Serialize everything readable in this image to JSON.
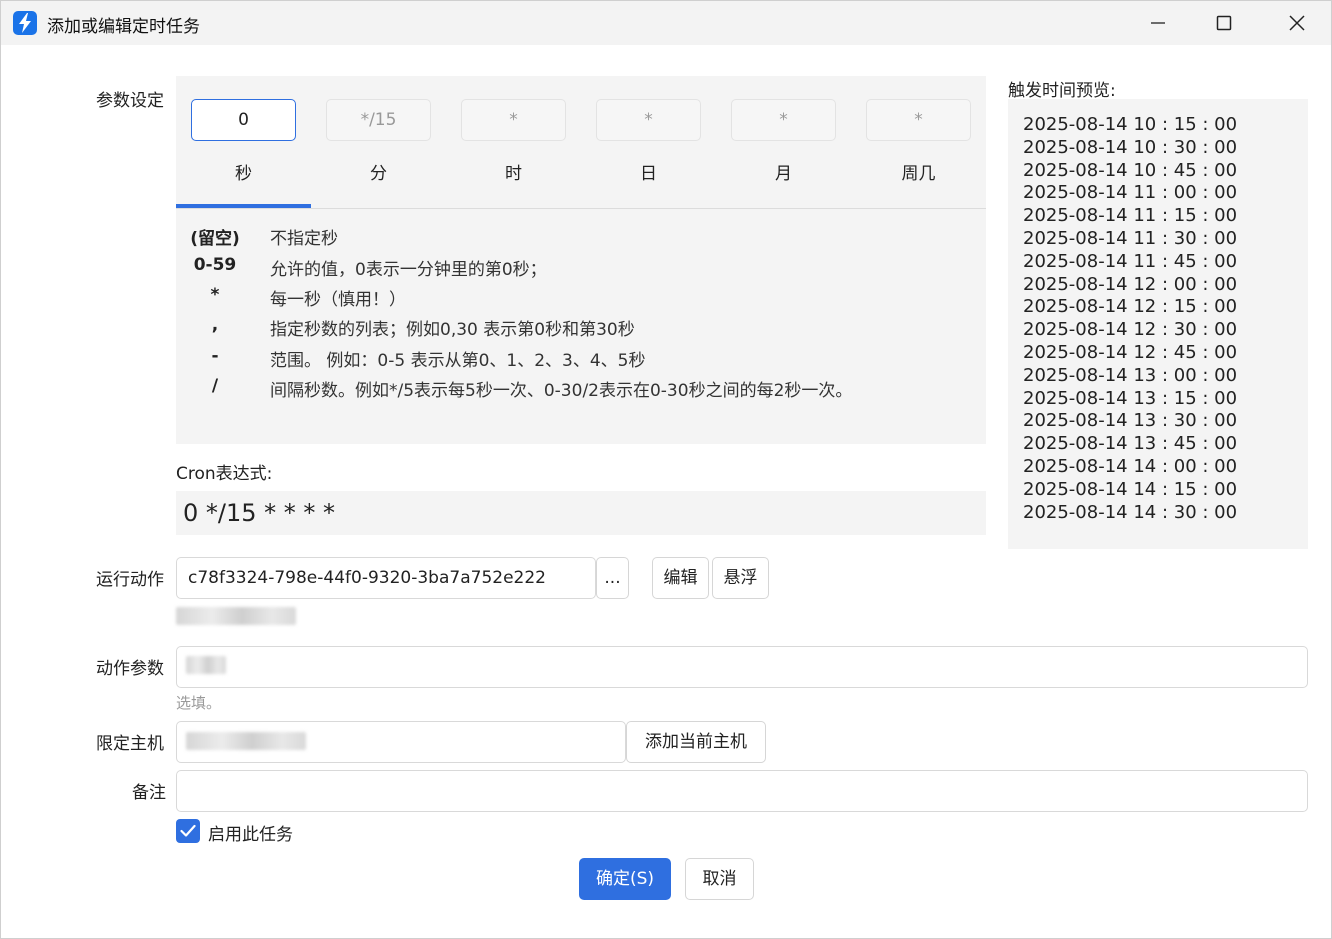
{
  "window": {
    "title": "添加或编辑定时任务",
    "icon": "lightning-icon"
  },
  "params": {
    "label": "参数设定",
    "fields": [
      {
        "value": "0",
        "active": true
      },
      {
        "value": "*/15",
        "active": false
      },
      {
        "value": "*",
        "active": false
      },
      {
        "value": "*",
        "active": false
      },
      {
        "value": "*",
        "active": false
      },
      {
        "value": "*",
        "active": false
      }
    ],
    "tabs": [
      "秒",
      "分",
      "时",
      "日",
      "月",
      "周几"
    ],
    "active_tab": 0,
    "help": [
      {
        "key": "(留空)",
        "desc": "不指定秒"
      },
      {
        "key": "0-59",
        "desc": "允许的值，0表示一分钟里的第0秒；"
      },
      {
        "key": "*",
        "desc": "每一秒（慎用！）"
      },
      {
        "key": ",",
        "desc": "指定秒数的列表；例如0,30 表示第0秒和第30秒"
      },
      {
        "key": "-",
        "desc": "范围。 例如：0-5 表示从第0、1、2、3、4、5秒"
      },
      {
        "key": "/",
        "desc": "间隔秒数。例如*/5表示每5秒一次、0-30/2表示在0-30秒之间的每2秒一次。"
      }
    ]
  },
  "cron": {
    "label": "Cron表达式:",
    "expression": "0 */15 * * * *"
  },
  "preview": {
    "label": "触发时间预览:",
    "items": [
      "2025-08-14 10 : 15 : 00",
      "2025-08-14 10 : 30 : 00",
      "2025-08-14 10 : 45 : 00",
      "2025-08-14 11 : 00 : 00",
      "2025-08-14 11 : 15 : 00",
      "2025-08-14 11 : 30 : 00",
      "2025-08-14 11 : 45 : 00",
      "2025-08-14 12 : 00 : 00",
      "2025-08-14 12 : 15 : 00",
      "2025-08-14 12 : 30 : 00",
      "2025-08-14 12 : 45 : 00",
      "2025-08-14 13 : 00 : 00",
      "2025-08-14 13 : 15 : 00",
      "2025-08-14 13 : 30 : 00",
      "2025-08-14 13 : 45 : 00",
      "2025-08-14 14 : 00 : 00",
      "2025-08-14 14 : 15 : 00",
      "2025-08-14 14 : 30 : 00"
    ]
  },
  "action": {
    "label": "运行动作",
    "value": "c78f3324-798e-44f0-9320-3ba7a752e222",
    "browse_label": "...",
    "edit_label": "编辑",
    "float_label": "悬浮"
  },
  "action_params": {
    "label": "动作参数",
    "hint": "选填。"
  },
  "host": {
    "label": "限定主机",
    "add_current_label": "添加当前主机"
  },
  "remark": {
    "label": "备注",
    "value": ""
  },
  "enable": {
    "label": "启用此任务",
    "checked": true
  },
  "footer": {
    "ok_label": "确定(S)",
    "cancel_label": "取消"
  },
  "colors": {
    "accent": "#2f6fe0",
    "panel_bg": "#f4f4f4"
  }
}
